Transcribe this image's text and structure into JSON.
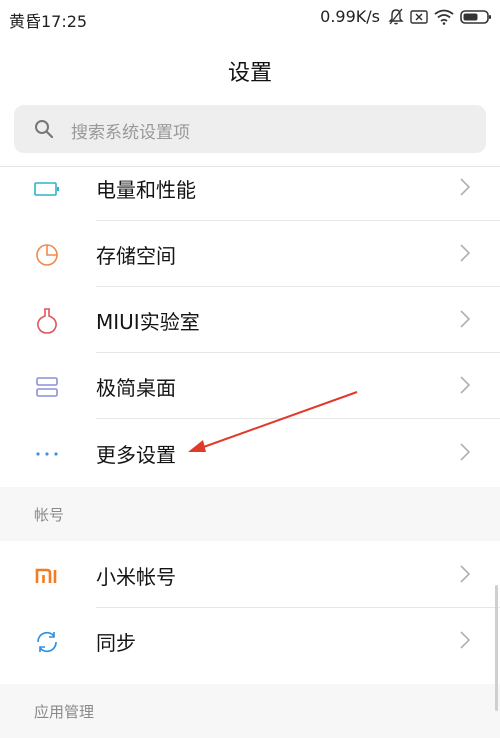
{
  "status_bar": {
    "time": "黄昏17:25",
    "speed": "0.99K/s"
  },
  "header": {
    "title": "设置"
  },
  "search": {
    "placeholder": "搜索系统设置项"
  },
  "items": [
    {
      "label": "电量和性能",
      "icon": "battery-icon",
      "color": "#2eb3c9"
    },
    {
      "label": "存储空间",
      "icon": "storage-pie-icon",
      "color": "#f08a4b"
    },
    {
      "label": "MIUI实验室",
      "icon": "flask-icon",
      "color": "#e0585b"
    },
    {
      "label": "极简桌面",
      "icon": "desktop-layout-icon",
      "color": "#8e8fd6"
    },
    {
      "label": "更多设置",
      "icon": "more-dots-icon",
      "color": "#3d92e4"
    }
  ],
  "sections": [
    {
      "title": "帐号",
      "items": [
        {
          "label": "小米帐号",
          "icon": "mi-logo-icon",
          "color": "#f47b20"
        },
        {
          "label": "同步",
          "icon": "sync-icon",
          "color": "#2a8fe0"
        }
      ]
    },
    {
      "title": "应用管理"
    }
  ],
  "annotation": {
    "arrow_color": "#e03a2b"
  }
}
